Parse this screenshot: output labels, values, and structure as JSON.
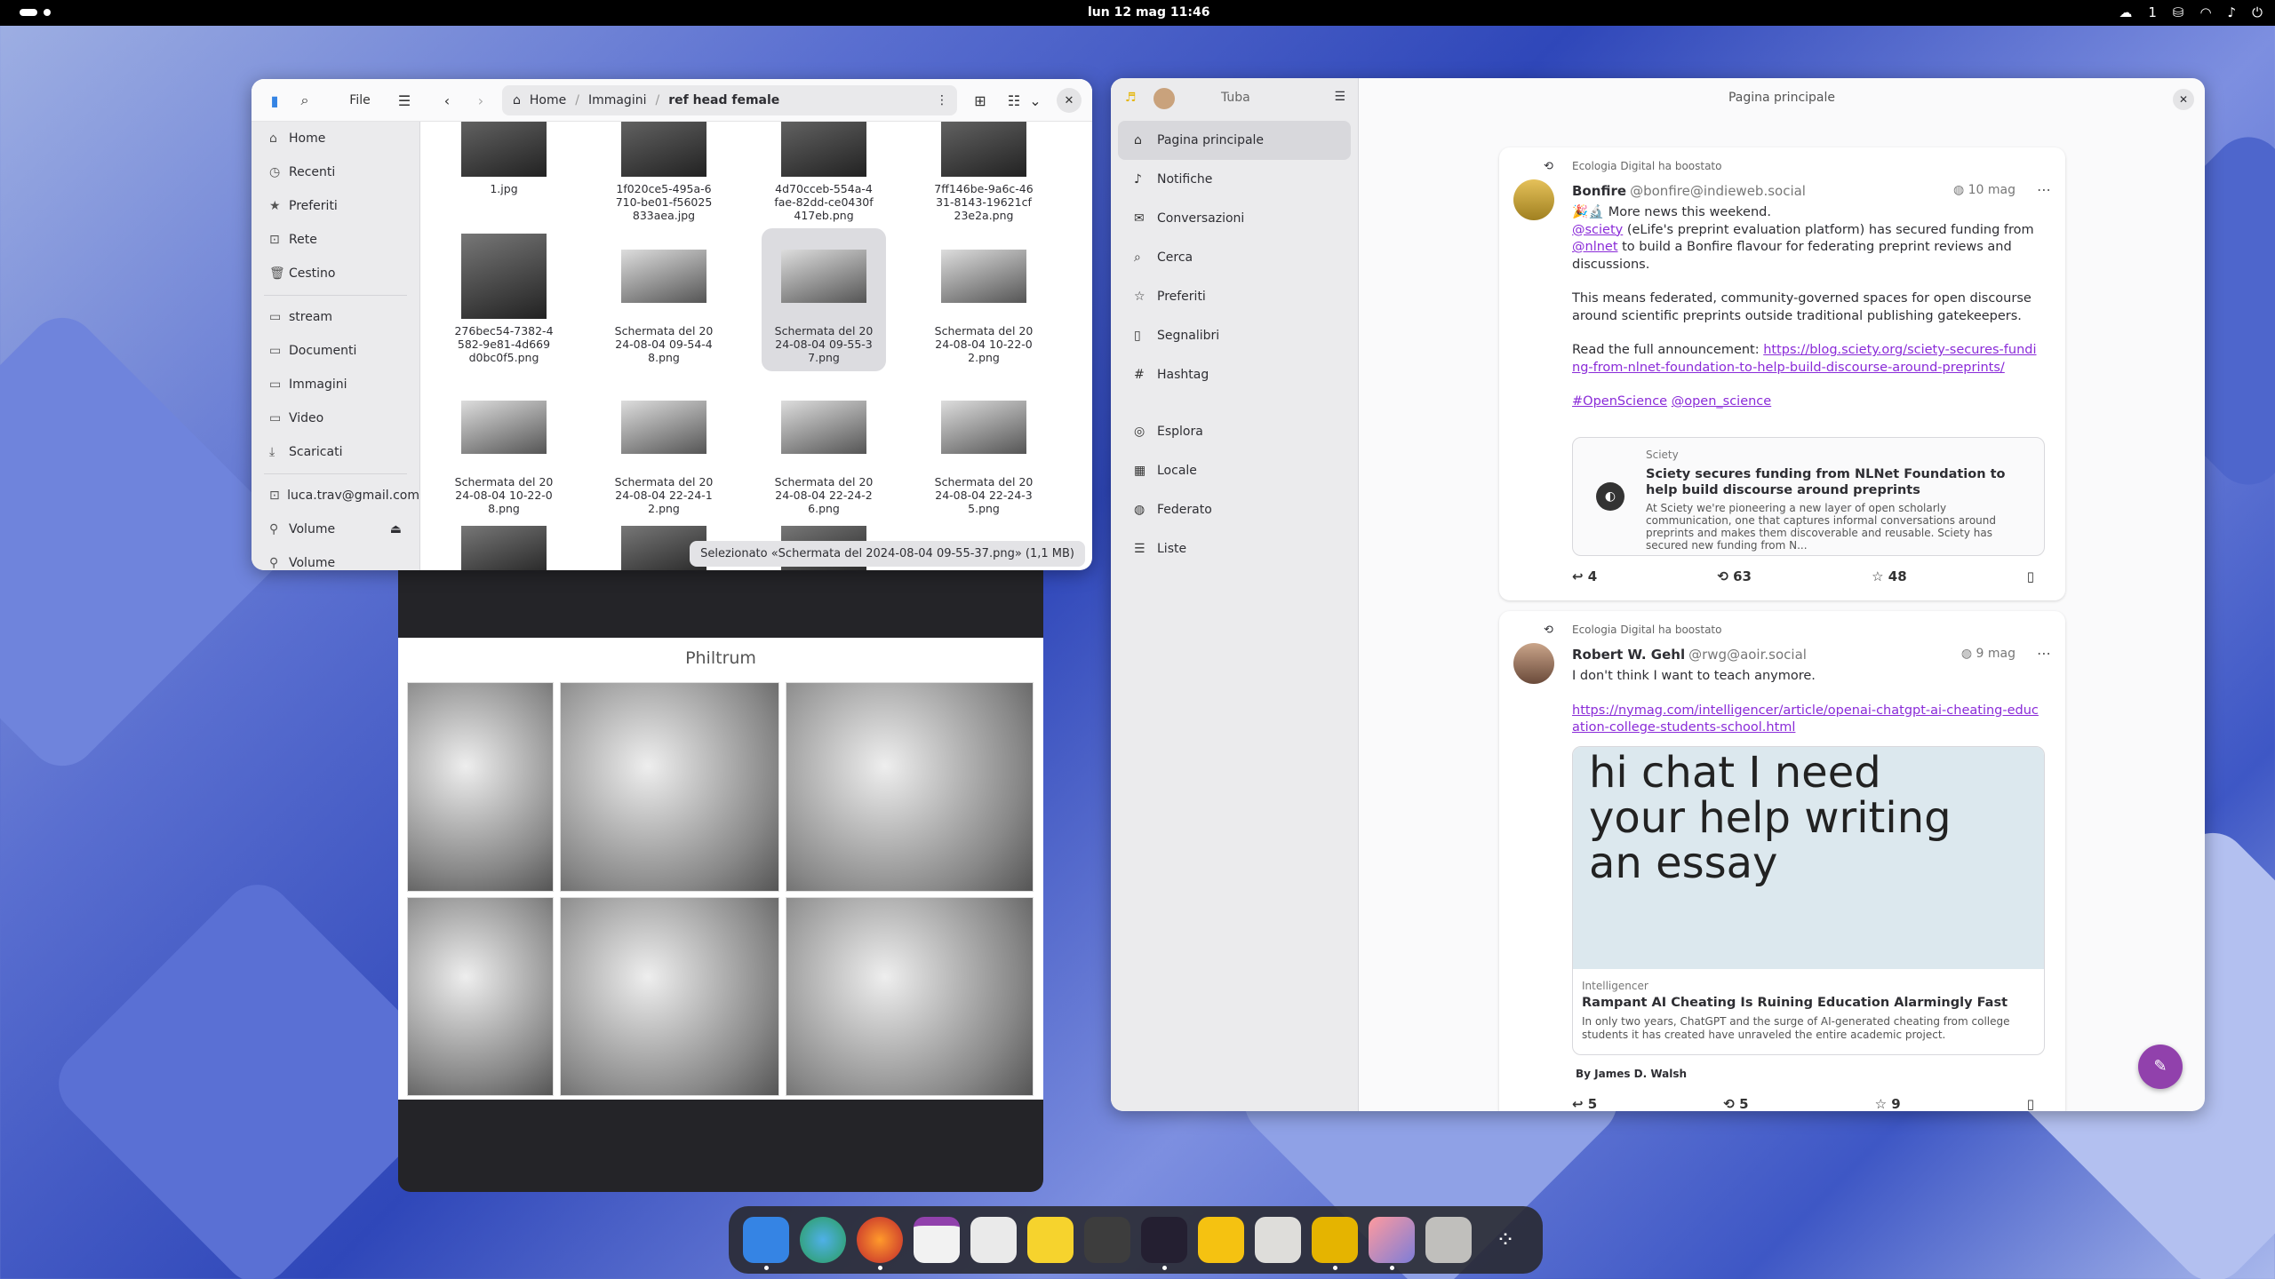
{
  "topbar": {
    "clock": "lun 12 mag  11:46",
    "tray_count": "1"
  },
  "files": {
    "menu_label": "File",
    "path": [
      "Home",
      "Immagini",
      "ref head female"
    ],
    "sidebar": [
      "Home",
      "Recenti",
      "Preferiti",
      "Rete",
      "Cestino",
      "stream",
      "Documenti",
      "Immagini",
      "Video",
      "Scaricati",
      "luca.trav@gmail.com",
      "Volume",
      "Volume"
    ],
    "sidebar_icons": [
      "home-icon",
      "clock-icon",
      "star-icon",
      "network-icon",
      "trash-icon",
      "folder-icon",
      "folder-icon",
      "folder-icon",
      "folder-icon",
      "download-icon",
      "network-icon",
      "drive-icon",
      "drive-icon"
    ],
    "items": [
      {
        "name": "1.jpg"
      },
      {
        "name": "1f020ce5-495a-6710-be01-f56025833aea.jpg"
      },
      {
        "name": "4d70cceb-554a-4fae-82dd-ce0430f417eb.png"
      },
      {
        "name": "7ff146be-9a6c-4631-8143-19621cf23e2a.png"
      },
      {
        "name": "276bec54-7382-4582-9e81-4d669d0bc0f5.png"
      },
      {
        "name": "Schermata del 2024-08-04 09-54-48.png"
      },
      {
        "name": "Schermata del 2024-08-04 09-55-37.png"
      },
      {
        "name": "Schermata del 2024-08-04 10-22-02.png"
      },
      {
        "name": "Schermata del 2024-08-04 10-22-08.png"
      },
      {
        "name": "Schermata del 2024-08-04 22-24-12.png"
      },
      {
        "name": "Schermata del 2024-08-04 22-24-26.png"
      },
      {
        "name": "Schermata del 2024-08-04 22-24-35.png"
      }
    ],
    "status": "Selezionato «Schermata del 2024-08-04 09-55-37.png» (1,1 MB)"
  },
  "viewer": {
    "title": "Philtrum"
  },
  "tuba": {
    "app_name": "Tuba",
    "page_title": "Pagina principale",
    "nav": [
      "Pagina principale",
      "Notifiche",
      "Conversazioni",
      "Cerca",
      "Preferiti",
      "Segnalibri",
      "Hashtag",
      "Esplora",
      "Locale",
      "Federato",
      "Liste"
    ],
    "nav_icons": [
      "home-icon",
      "bell-icon",
      "mail-icon",
      "search-icon",
      "star-icon",
      "bookmark-icon",
      "hashtag-icon",
      "compass-icon",
      "building-icon",
      "globe-icon",
      "list-icon"
    ],
    "posts": [
      {
        "boost": "Ecologia Digital ha boostato",
        "name": "Bonfire",
        "handle": "@bonfire@indieweb.social",
        "date": "10 mag",
        "l1": "🎉🔬 More news this weekend.",
        "m1": "@sciety",
        "t1": " (eLife's preprint evaluation platform) has secured funding from ",
        "m2": "@nlnet",
        "t2": " to build a Bonfire flavour for federating preprint reviews and discussions.",
        "p2": "This means federated, community-governed spaces for open discourse around scientific preprints outside traditional publishing gatekeepers.",
        "p3": "Read the full announcement: ",
        "url": "https://blog.sciety.org/sciety-secures-funding-from-nlnet-foundation-to-help-build-discourse-around-preprints/",
        "tag1": "#OpenScience",
        "tag2": "@open_science",
        "card": {
          "source": "Sciety",
          "title": "Sciety secures funding from NLNet Foundation to help build discourse around preprints",
          "desc": "At Sciety we're pioneering a new layer of open scholarly communication, one that captures informal conversations around preprints and makes them discoverable and reusable. Sciety has secured new funding from N..."
        },
        "replies": "4",
        "boosts": "63",
        "favs": "48"
      },
      {
        "boost": "Ecologia Digital ha boostato",
        "name": "Robert W. Gehl",
        "handle": "@rwg@aoir.social",
        "date": "9 mag",
        "text": "I don't think I want to teach anymore.",
        "url": "https://nymag.com/intelligencer/article/openai-chatgpt-ai-cheating-education-college-students-school.html",
        "image_text": "hi chat I need your help writing an essay",
        "card": {
          "source": "Intelligencer",
          "title": "Rampant AI Cheating Is Ruining Education Alarmingly Fast",
          "desc": "In only two years, ChatGPT and the surge of AI-generated cheating from college students it has created have unraveled the entire academic project."
        },
        "author": "By James D. Walsh",
        "replies": "5",
        "boosts": "5",
        "favs": "9"
      }
    ]
  },
  "colors": {
    "accent": "#9141ac",
    "link": "#8a2bd8"
  }
}
